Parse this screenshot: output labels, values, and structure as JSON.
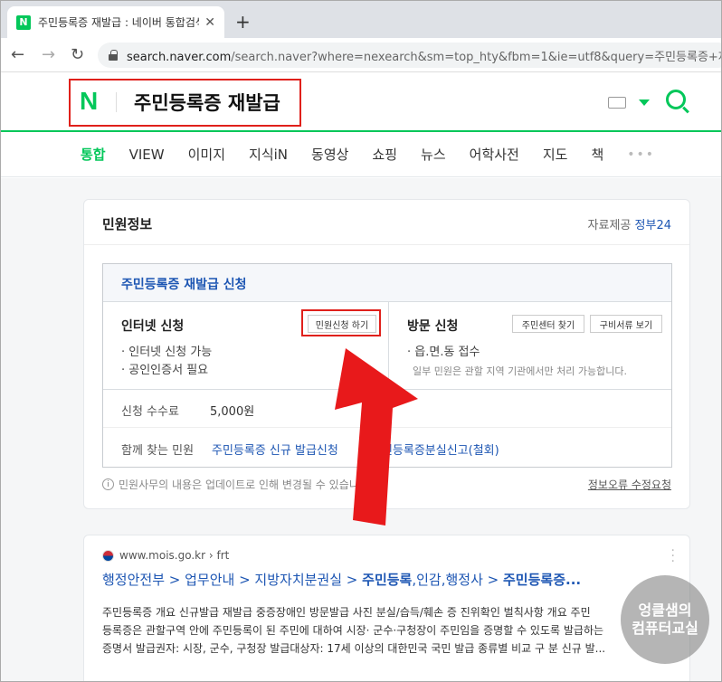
{
  "browser": {
    "tab_title": "주민등록증 재발급 : 네이버 통합검색",
    "tab_close": "✕",
    "new_tab": "+",
    "back": "←",
    "forward": "→",
    "reload": "↻",
    "url_host": "search.naver.com",
    "url_path": "/search.naver?where=nexearch&sm=top_hty&fbm=1&ie=utf8&query=주민등록증+재"
  },
  "header": {
    "logo": "N",
    "query": "주민등록증 재발급"
  },
  "nav": {
    "tabs": [
      "통합",
      "VIEW",
      "이미지",
      "지식iN",
      "동영상",
      "쇼핑",
      "뉴스",
      "어학사전",
      "지도",
      "책"
    ],
    "more": "•••"
  },
  "civil": {
    "title": "민원정보",
    "provider_label": "자료제공",
    "provider_name": "정부24",
    "service_title": "주민등록증 재발급 신청",
    "internet": {
      "heading": "인터넷 신청",
      "button": "민원신청 하기",
      "bullets": [
        "· 인터넷 신청 가능",
        "· 공인인증서 필요"
      ]
    },
    "visit": {
      "heading": "방문 신청",
      "button_center": "주민센터 찾기",
      "button_docs": "구비서류 보기",
      "bullet": "· 읍.면.동 접수",
      "note": "일부 민원은 관할 지역 기관에서만 처리 가능합니다."
    },
    "fee_label": "신청 수수료",
    "fee_value": "5,000원",
    "related_label": "함께 찾는 민원",
    "related_1": "주민등록증 신규 발급신청",
    "related_2": "주민등록증분실신고(철회)",
    "info_icon": "i",
    "info_note": "민원사무의 내용은 업데이트로 인해 변경될 수 있습니다.",
    "report": "정보오류 수정요청"
  },
  "result": {
    "site": "www.mois.go.kr",
    "site_path": "› frt",
    "title_parts": [
      "행정안전부",
      " > 업무안내 > 지방자치분권실 > ",
      "주민등록",
      ",인감,행정사 > ",
      "주민등록증..."
    ],
    "snippet_1": "주민등록증 개요 신규발급 재발급 중증장애인 방문발급 사진 분실/습득/훼손 증 진위확인 벌칙사항 개요 주민",
    "snippet_2": "등록증은 관할구역 안에 주민등록이 된 주민에 대하여 시장· 군수·구청장이 주민임을 증명할 수 있도록 발급하는",
    "snippet_3": "증명서 발급권자: 시장, 군수, 구청장 발급대상자: 17세 이상의 대한민국 국민 발급 종류별 비교 구 분 신규 발..."
  },
  "watermark": {
    "line1": "엉클샘의",
    "line2": "컴퓨터교실"
  },
  "colors": {
    "naver_green": "#03c75a",
    "highlight_red": "#e0201b",
    "link_blue": "#1d56b3"
  }
}
